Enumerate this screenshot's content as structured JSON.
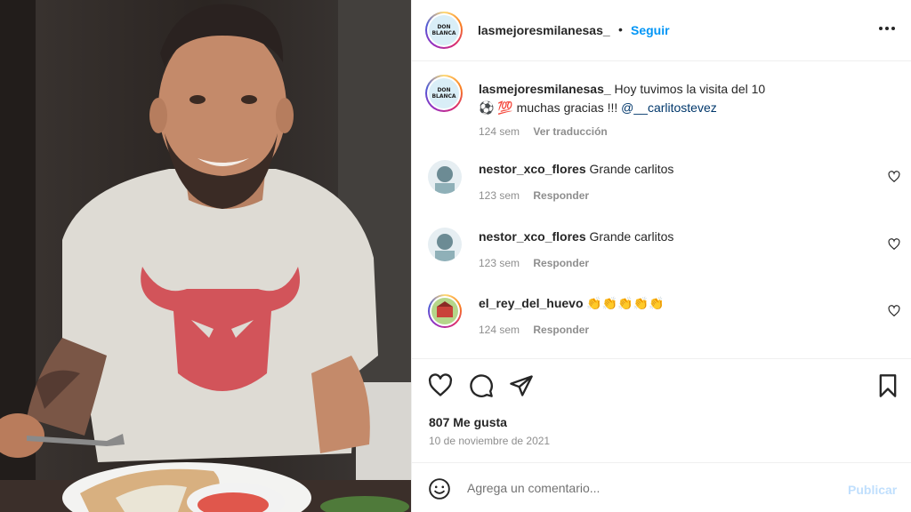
{
  "post": {
    "username": "lasmejoresmilanesas_",
    "follow_label": "Seguir",
    "avatar_text_top": "DON",
    "avatar_text_bottom": "BLANCA"
  },
  "caption": {
    "username": "lasmejoresmilanesas_",
    "text_line1": "Hoy tuvimos la visita del 10",
    "emoji": "⚽ 💯",
    "text_line2": " muchas gracias !!! ",
    "mention": "@__carlitostevez",
    "time": "124 sem",
    "translate_label": "Ver traducción"
  },
  "comments": [
    {
      "username": "nestor_xco_flores",
      "text": "Grande carlitos",
      "time": "123 sem",
      "reply_label": "Responder"
    },
    {
      "username": "nestor_xco_flores",
      "text": "Grande carlitos",
      "time": "123 sem",
      "reply_label": "Responder"
    },
    {
      "username": "el_rey_del_huevo",
      "text": "👏👏👏👏👏",
      "time": "124 sem",
      "reply_label": "Responder"
    }
  ],
  "stats": {
    "likes": "807 Me gusta",
    "date": "10 de noviembre de 2021"
  },
  "add_comment": {
    "placeholder": "Agrega un comentario...",
    "publish_label": "Publicar"
  },
  "icons": {
    "header_more": "more-horizontal-icon",
    "like": "heart-icon",
    "comment": "comment-icon",
    "share": "send-icon",
    "save": "bookmark-icon",
    "emoji": "emoji-icon"
  },
  "colors": {
    "link": "#0095f6",
    "mention": "#00376b",
    "muted": "#8e8e8e",
    "publish_disabled": "#c0dffd",
    "shirt_logo": "#d2545a"
  }
}
